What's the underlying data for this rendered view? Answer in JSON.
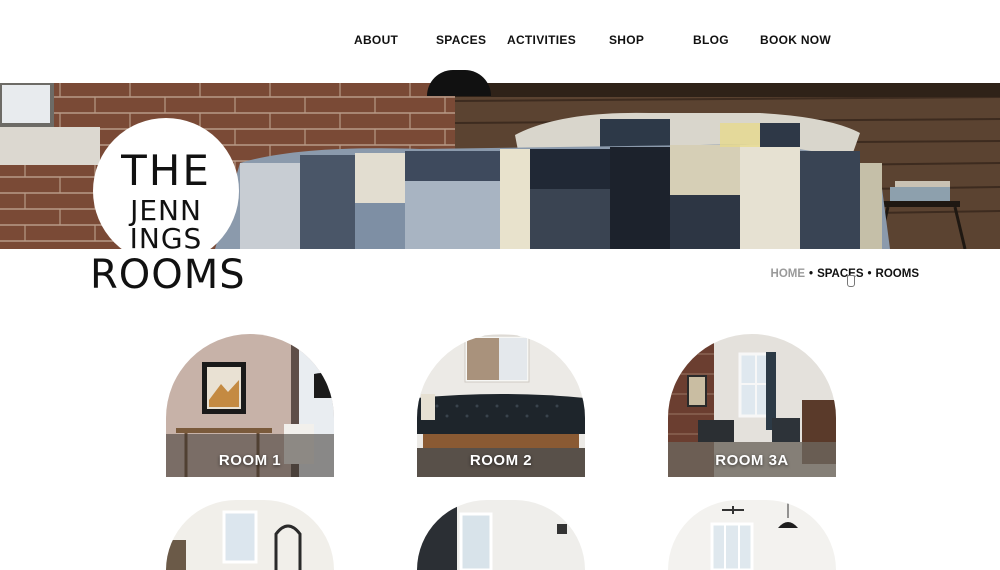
{
  "nav": {
    "items": [
      {
        "label": "ABOUT"
      },
      {
        "label": "SPACES"
      },
      {
        "label": "ACTIVITIES"
      },
      {
        "label": "SHOP"
      },
      {
        "label": "BLOG"
      },
      {
        "label": "BOOK NOW"
      }
    ]
  },
  "logo": {
    "line1": "THE",
    "line2": "JENN",
    "line3": "INGS"
  },
  "page_title": "ROOMS",
  "breadcrumb": {
    "home": "HOME",
    "separator": "•",
    "spaces": "SPACES",
    "current": "ROOMS"
  },
  "rooms": [
    {
      "label": "ROOM 1"
    },
    {
      "label": "ROOM 2"
    },
    {
      "label": "ROOM 3A"
    }
  ]
}
